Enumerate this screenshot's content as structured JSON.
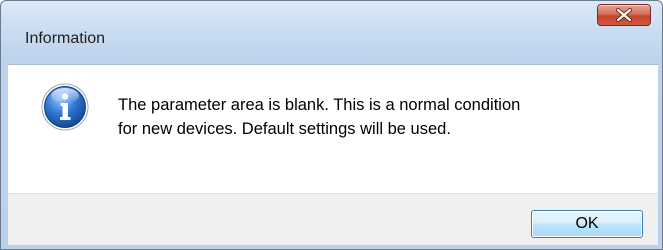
{
  "window": {
    "title": "Information"
  },
  "titlebar": {
    "close_icon": "close-icon"
  },
  "dialog": {
    "icon": "info-icon",
    "message_line1": "The parameter area is blank. This is a normal condition",
    "message_line2": "for new devices. Default settings will be used."
  },
  "footer": {
    "ok_label": "OK"
  },
  "colors": {
    "title_glass": "#c9dcf1",
    "close_red": "#c3432b",
    "info_blue": "#1f5fb8",
    "ok_button_blue": "#bee6fd",
    "footer_gray": "#f0f0f0"
  }
}
